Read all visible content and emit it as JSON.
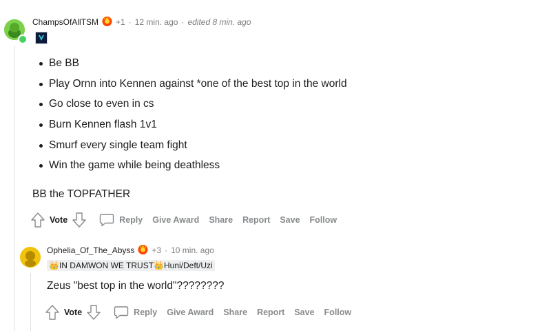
{
  "comments": [
    {
      "username": "ChampsOfAllTSM",
      "karma": "+1",
      "time": "12 min. ago",
      "edited": "edited 8 min. ago",
      "bullets": [
        "Be BB",
        "Play Ornn into Kennen against *one of the best top in the world",
        "Go close to even in cs",
        "Burn Kennen flash 1v1",
        "Smurf every single team fight",
        "Win the game while being deathless"
      ],
      "text": "BB the TOPFATHER"
    },
    {
      "username": "Ophelia_Of_The_Abyss",
      "karma": "+3",
      "time": "10 min. ago",
      "flair": "👑IN DAMWON WE TRUST👑Huni/Deft/Uzi",
      "text": "Zeus \"best top in the world\"????????"
    }
  ],
  "actions": {
    "vote": "Vote",
    "reply": "Reply",
    "give_award": "Give Award",
    "share": "Share",
    "report": "Report",
    "save": "Save",
    "follow": "Follow"
  },
  "meta": {
    "separator": "·"
  },
  "colors": {
    "online": "#46d160",
    "avatar1": "#7cd14c",
    "avatar2": "#f2c30c",
    "award": "#ff4500"
  }
}
